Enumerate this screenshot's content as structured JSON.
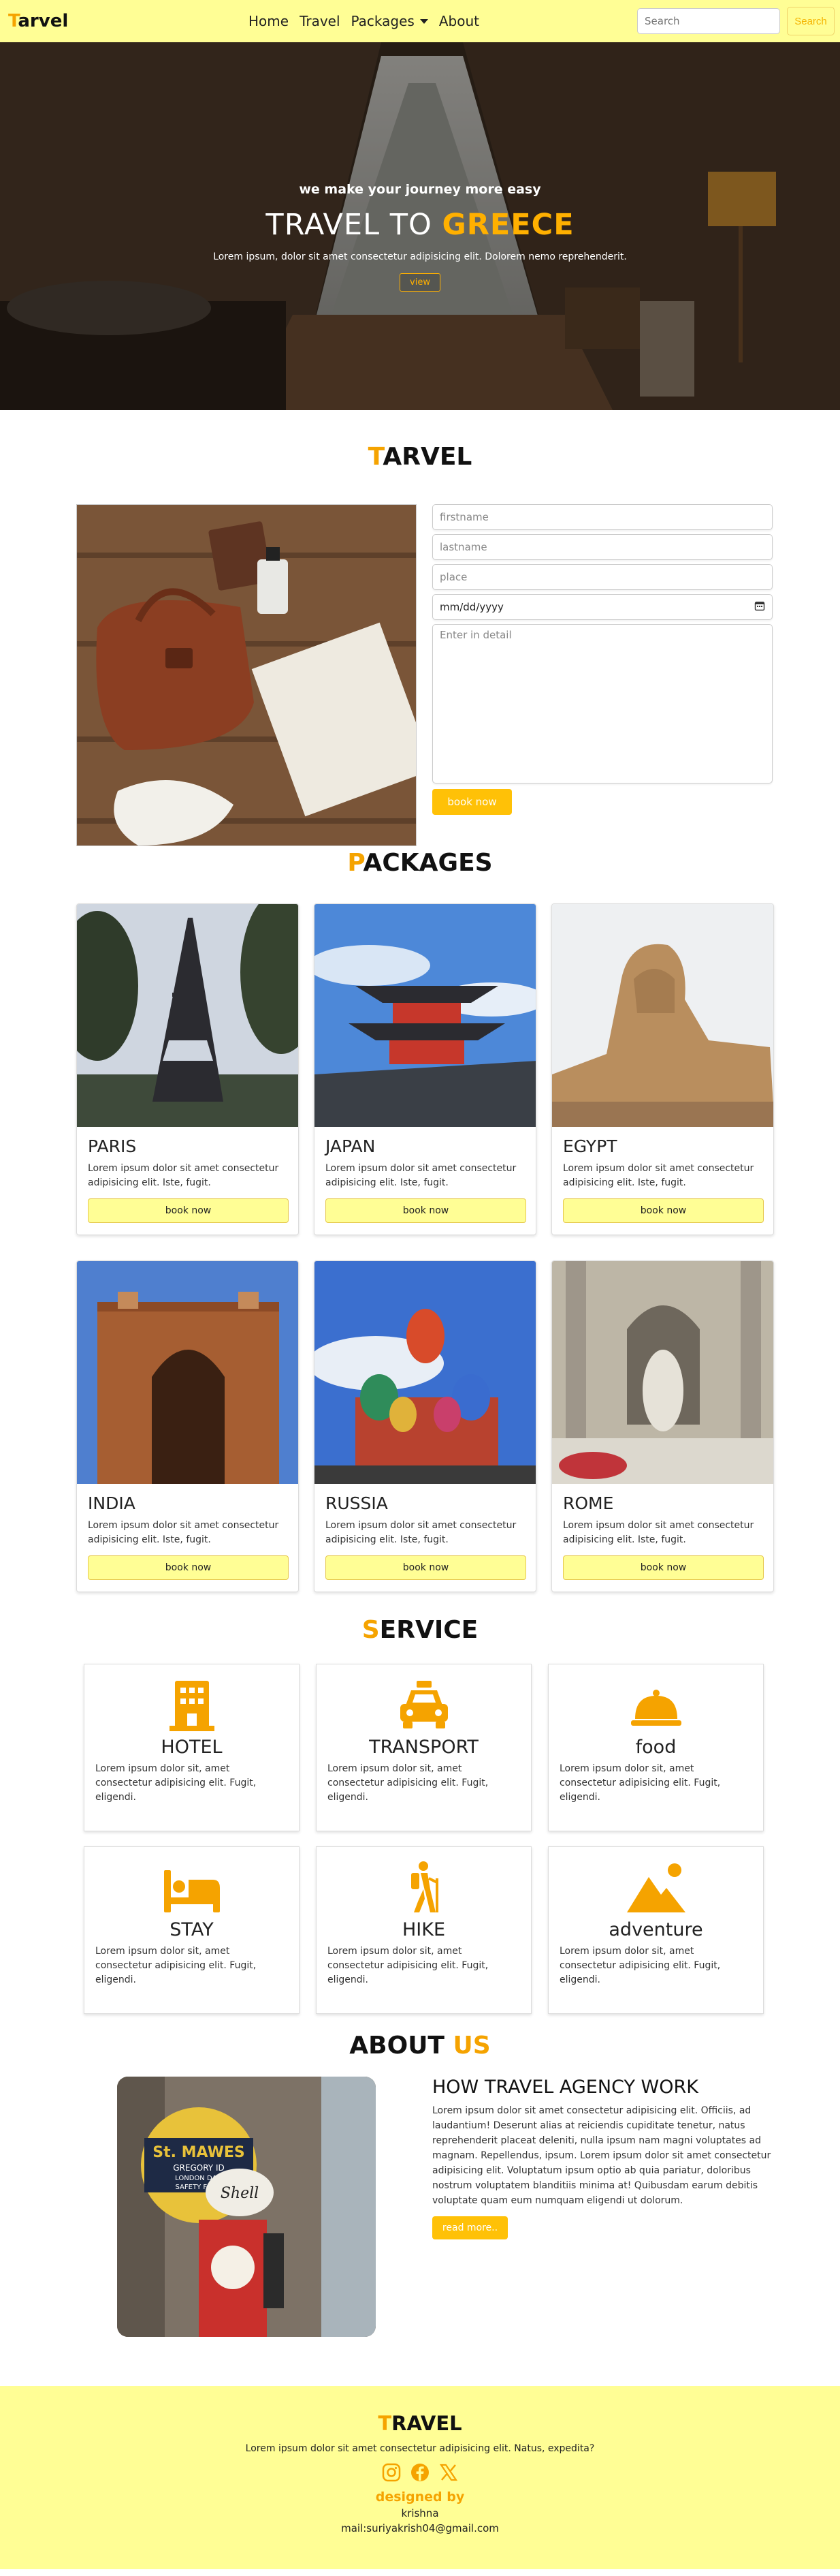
{
  "nav": {
    "brand_first": "T",
    "brand_rest": "arvel",
    "links": [
      "Home",
      "Travel",
      "Packages",
      "About"
    ],
    "search_placeholder": "Search",
    "search_button": "Search"
  },
  "hero": {
    "subtitle": "we make your journey more easy",
    "title_plain": "TRAVEL TO ",
    "title_highlight": "GREECE",
    "description": "Lorem ipsum, dolor sit amet consectetur adipisicing elit. Dolorem nemo reprehenderit.",
    "button": "view"
  },
  "booking": {
    "title_first": "T",
    "title_rest": "ARVEL",
    "firstname_placeholder": "firstname",
    "lastname_placeholder": "lastname",
    "place_placeholder": "place",
    "date_placeholder": "mm/dd/yyyy",
    "detail_placeholder": "Enter in detail",
    "button": "book now"
  },
  "packages": {
    "title_first": "P",
    "title_rest": "ACKAGES",
    "items": [
      {
        "name": "PARIS",
        "desc": "Lorem ipsum dolor sit amet consectetur adipisicing elit. Iste, fugit.",
        "button": "book now"
      },
      {
        "name": "JAPAN",
        "desc": "Lorem ipsum dolor sit amet consectetur adipisicing elit. Iste, fugit.",
        "button": "book now"
      },
      {
        "name": "EGYPT",
        "desc": "Lorem ipsum dolor sit amet consectetur adipisicing elit. Iste, fugit.",
        "button": "book now"
      },
      {
        "name": "INDIA",
        "desc": "Lorem ipsum dolor sit amet consectetur adipisicing elit. Iste, fugit.",
        "button": "book now"
      },
      {
        "name": "RUSSIA",
        "desc": "Lorem ipsum dolor sit amet consectetur adipisicing elit. Iste, fugit.",
        "button": "book now"
      },
      {
        "name": "ROME",
        "desc": "Lorem ipsum dolor sit amet consectetur adipisicing elit. Iste, fugit.",
        "button": "book now"
      }
    ]
  },
  "service": {
    "title_first": "S",
    "title_rest": "ERVICE",
    "items": [
      {
        "name": "HOTEL",
        "icon": "hotel-icon",
        "desc": "Lorem ipsum dolor sit, amet consectetur adipisicing elit. Fugit, eligendi."
      },
      {
        "name": "TRANSPORT",
        "icon": "taxi-icon",
        "desc": "Lorem ipsum dolor sit, amet consectetur adipisicing elit. Fugit, eligendi."
      },
      {
        "name": "food",
        "icon": "cloche-icon",
        "desc": "Lorem ipsum dolor sit, amet consectetur adipisicing elit. Fugit, eligendi."
      },
      {
        "name": "STAY",
        "icon": "bed-icon",
        "desc": "Lorem ipsum dolor sit, amet consectetur adipisicing elit. Fugit, eligendi."
      },
      {
        "name": "HIKE",
        "icon": "hiker-icon",
        "desc": "Lorem ipsum dolor sit, amet consectetur adipisicing elit. Fugit, eligendi."
      },
      {
        "name": "adventure",
        "icon": "mountain-icon",
        "desc": "Lorem ipsum dolor sit, amet consectetur adipisicing elit. Fugit, eligendi."
      }
    ]
  },
  "about": {
    "title_plain": "ABOUT ",
    "title_highlight": "US",
    "heading": "HOW TRAVEL AGENCY WORK",
    "body": "Lorem ipsum dolor sit amet consectetur adipisicing elit. Officiis, ad laudantium! Deserunt alias at reiciendis cupiditate tenetur, natus reprehenderit placeat deleniti, nulla ipsum nam magni voluptates ad magnam. Repellendus, ipsum. Lorem ipsum dolor sit amet consectetur adipisicing elit. Voluptatum ipsum optio ab quia pariatur, doloribus nostrum voluptatem blanditiis minima at! Quibusdam earum debitis voluptate quam eum numquam eligendi ut dolorum.",
    "button": "read more..",
    "image_sign_lines": [
      "St. MAWES",
      "GREGORY ID",
      "LONDON DAIL",
      "SAFETY FIRST",
      "Shell"
    ]
  },
  "footer": {
    "brand_first": "T",
    "brand_rest": "RAVEL",
    "desc": "Lorem ipsum dolor sit amet consectetur adipisicing elit. Natus, expedita?",
    "social_icons": [
      "instagram-icon",
      "facebook-icon",
      "x-twitter-icon"
    ],
    "designed_by": "designed by",
    "author": "krishna",
    "mail": "mail:suriyakrish04@gmail.com"
  },
  "colors": {
    "accent": "#f5a300",
    "nav_bg": "#fffe95",
    "button_yellow": "#ffc107"
  }
}
